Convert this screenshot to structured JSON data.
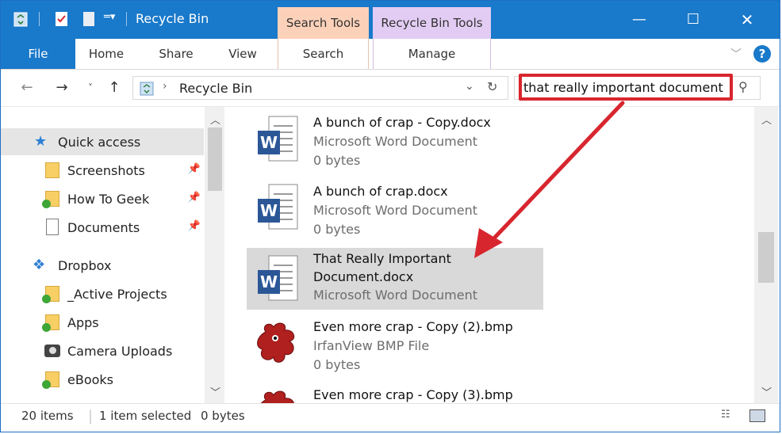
{
  "window": {
    "title": "Recycle Bin"
  },
  "context_tabs": {
    "search_tools": "Search Tools",
    "recycle_bin_tools": "Recycle Bin Tools"
  },
  "ribbon": {
    "file": "File",
    "home": "Home",
    "share": "Share",
    "view": "View",
    "search": "Search",
    "manage": "Manage"
  },
  "address": {
    "crumb": "Recycle Bin"
  },
  "search": {
    "value": "that really important document"
  },
  "nav": {
    "quick_access": "Quick access",
    "items": [
      {
        "label": "Screenshots"
      },
      {
        "label": "How To Geek"
      },
      {
        "label": "Documents"
      },
      {
        "label": "Dropbox"
      },
      {
        "label": "_Active Projects"
      },
      {
        "label": "Apps"
      },
      {
        "label": "Camera Uploads"
      },
      {
        "label": "eBooks"
      }
    ]
  },
  "files": [
    {
      "name": "A bunch of crap - Copy.docx",
      "type": "Microsoft Word Document",
      "size": "0 bytes"
    },
    {
      "name": "A bunch of crap.docx",
      "type": "Microsoft Word Document",
      "size": "0 bytes"
    },
    {
      "name_line1": "That Really Important",
      "name_line2": "Document.docx",
      "type": "Microsoft Word Document"
    },
    {
      "name": "Even more crap - Copy (2).bmp",
      "type": "IrfanView BMP File",
      "size": "0 bytes"
    },
    {
      "name": "Even more crap - Copy (3).bmp"
    }
  ],
  "status": {
    "count": "20 items",
    "selected": "1 item selected",
    "size": "0 bytes"
  },
  "colors": {
    "accent": "#1979ca",
    "highlight": "#d8262e",
    "search_tab": "#fcd1b9",
    "manage_tab": "#e3ccf3"
  },
  "icons": [
    "recycle-bin-icon",
    "properties-icon",
    "new-folder-icon",
    "customize-qat-icon",
    "minimize-icon",
    "maximize-icon",
    "close-icon",
    "collapse-ribbon-icon",
    "help-icon",
    "back-icon",
    "forward-icon",
    "recent-locations-icon",
    "up-icon",
    "refresh-icon",
    "search-icon",
    "word-document-icon",
    "bmp-file-icon",
    "details-view-icon",
    "large-icons-view-icon"
  ]
}
